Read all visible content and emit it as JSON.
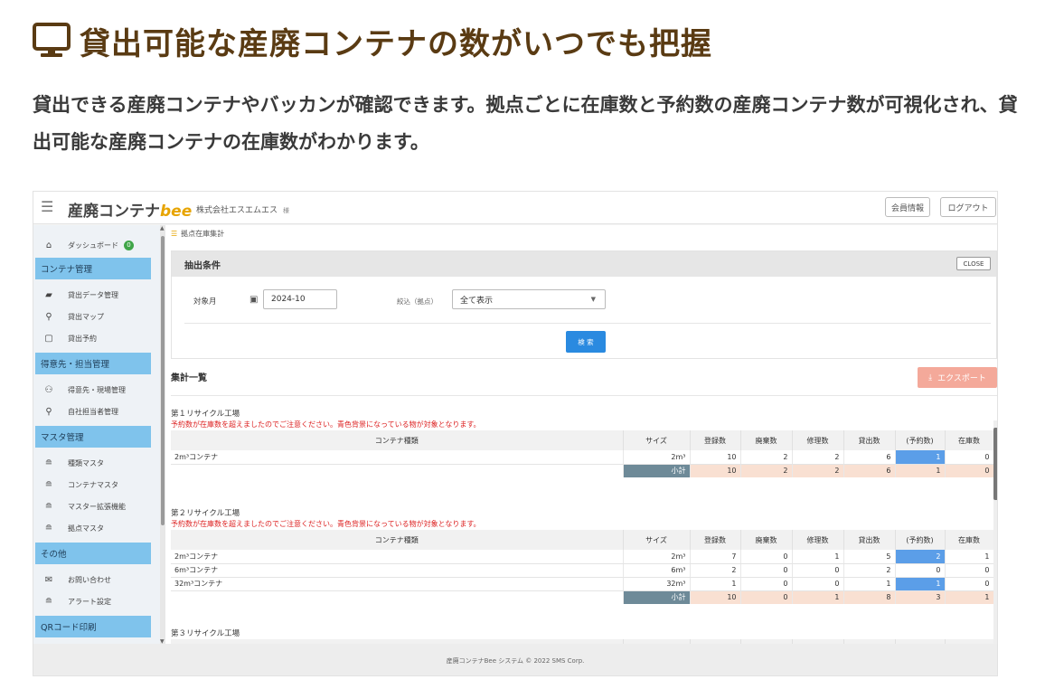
{
  "promo": {
    "icon": "monitor-icon",
    "title": "貸出可能な産廃コンテナの数がいつでも把握",
    "description": "貸出できる産廃コンテナやバッカンが確認できます。拠点ごとに在庫数と予約数の産廃コンテナ数が可視化され、貸出可能な産廃コンテナの在庫数がわかります。"
  },
  "app": {
    "logo_text": "産廃コンテナ",
    "logo_bee": "bee",
    "company": "株式会社エスエムエス",
    "company_suffix": "様",
    "member_info_button": "会員情報",
    "logout_button": "ログアウト",
    "footer": "産廃コンテナBee システム © 2022 SMS Corp."
  },
  "sidebar": {
    "dashboard": {
      "label": "ダッシュボード",
      "badge": "0",
      "icon": "home-icon"
    },
    "sections": [
      {
        "label": "コンテナ管理",
        "items": [
          {
            "label": "貸出データ管理",
            "icon": "truck-icon"
          },
          {
            "label": "貸出マップ",
            "icon": "map-pin-icon"
          },
          {
            "label": "貸出予約",
            "icon": "calendar-icon"
          }
        ]
      },
      {
        "label": "得意先・担当管理",
        "items": [
          {
            "label": "得意先・現場管理",
            "icon": "users-icon"
          },
          {
            "label": "自社担当者管理",
            "icon": "user-icon"
          }
        ]
      },
      {
        "label": "マスタ管理",
        "items": [
          {
            "label": "種類マスタ",
            "icon": "database-icon"
          },
          {
            "label": "コンテナマスタ",
            "icon": "database-icon"
          },
          {
            "label": "マスター拡張機能",
            "icon": "database-icon"
          },
          {
            "label": "拠点マスタ",
            "icon": "database-icon"
          }
        ]
      },
      {
        "label": "その他",
        "items": [
          {
            "label": "お問い合わせ",
            "icon": "mail-icon"
          },
          {
            "label": "アラート設定",
            "icon": "database-icon"
          }
        ]
      },
      {
        "label": "QRコード印刷",
        "items": []
      }
    ]
  },
  "main": {
    "breadcrumb": "拠点在庫集計",
    "filter": {
      "title": "抽出条件",
      "close_label": "CLOSE",
      "month_label": "対象月",
      "month_value": "2024-10",
      "base_label": "絞込（拠点）",
      "base_value": "全て表示",
      "search_label": "検 索"
    },
    "list_title": "集計一覧",
    "export_label": "エクスポート",
    "columns": [
      "コンテナ種類",
      "サイズ",
      "登録数",
      "廃棄数",
      "修理数",
      "貸出数",
      "(予約数)",
      "在庫数"
    ],
    "subtotal_label": "小計",
    "factories": [
      {
        "name": "第１リサイクル工場",
        "warning": "予約数が在庫数を超えましたのでご注意ください。青色背景になっている物が対象となります。",
        "rows": [
          {
            "type": "2m³コンテナ",
            "size": "2m³",
            "registered": "10",
            "disposed": "2",
            "repair": "2",
            "lent": "6",
            "reserved": "1",
            "stock": "0",
            "alert": true
          }
        ],
        "subtotal": {
          "registered": "10",
          "disposed": "2",
          "repair": "2",
          "lent": "6",
          "reserved": "1",
          "stock": "0"
        }
      },
      {
        "name": "第２リサイクル工場",
        "warning": "予約数が在庫数を超えましたのでご注意ください。青色背景になっている物が対象となります。",
        "rows": [
          {
            "type": "2m³コンテナ",
            "size": "2m³",
            "registered": "7",
            "disposed": "0",
            "repair": "1",
            "lent": "5",
            "reserved": "2",
            "stock": "1",
            "alert": true
          },
          {
            "type": "6m³コンテナ",
            "size": "6m³",
            "registered": "2",
            "disposed": "0",
            "repair": "0",
            "lent": "2",
            "reserved": "0",
            "stock": "0",
            "alert": false
          },
          {
            "type": "32m³コンテナ",
            "size": "32m³",
            "registered": "1",
            "disposed": "0",
            "repair": "0",
            "lent": "1",
            "reserved": "1",
            "stock": "0",
            "alert": true
          }
        ],
        "subtotal": {
          "registered": "10",
          "disposed": "0",
          "repair": "1",
          "lent": "8",
          "reserved": "3",
          "stock": "1"
        }
      },
      {
        "name": "第３リサイクル工場",
        "warning": "",
        "rows": [],
        "subtotal": null
      }
    ]
  },
  "colors": {
    "promo_title": "#5a3b13",
    "section_bg": "#7fc3ec",
    "search_button": "#2a8ae0",
    "export_button": "#f4a99a",
    "alert_cell": "#5b9ee8",
    "subtotal_row": "#f9e0d2",
    "warning_text": "#dd2222"
  }
}
